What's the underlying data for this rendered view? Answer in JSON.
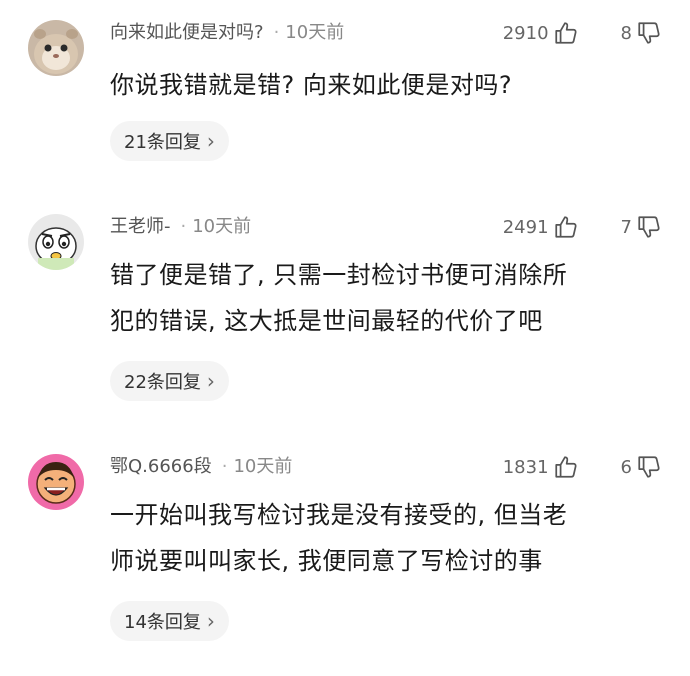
{
  "comments": [
    {
      "username": "向来如此便是对吗?",
      "dot": "·",
      "time": "10天前",
      "likes": "2910",
      "dislikes": "8",
      "lines": [
        "你说我错就是错? 向来如此便是对吗?"
      ],
      "replies": "21条回复",
      "avatar": "hamster-avatar"
    },
    {
      "username": "王老师-",
      "dot": "·",
      "time": "10天前",
      "likes": "2491",
      "dislikes": "7",
      "lines": [
        "错了便是错了, 只需一封检讨书便可消除所",
        "犯的错误, 这大抵是世间最轻的代价了吧"
      ],
      "replies": "22条回复",
      "avatar": "cartoon-face-avatar"
    },
    {
      "username": "鄂Q.6666段",
      "dot": "·",
      "time": "10天前",
      "likes": "1831",
      "dislikes": "6",
      "lines": [
        "一开始叫我写检讨我是没有接受的, 但当老",
        "师说要叫叫家长, 我便同意了写检讨的事"
      ],
      "replies": "14条回复",
      "avatar": "laughing-man-avatar"
    }
  ],
  "icons": {
    "like": "thumbs-up-icon",
    "dislike": "thumbs-down-icon",
    "chevron": "chevron-right-icon"
  }
}
